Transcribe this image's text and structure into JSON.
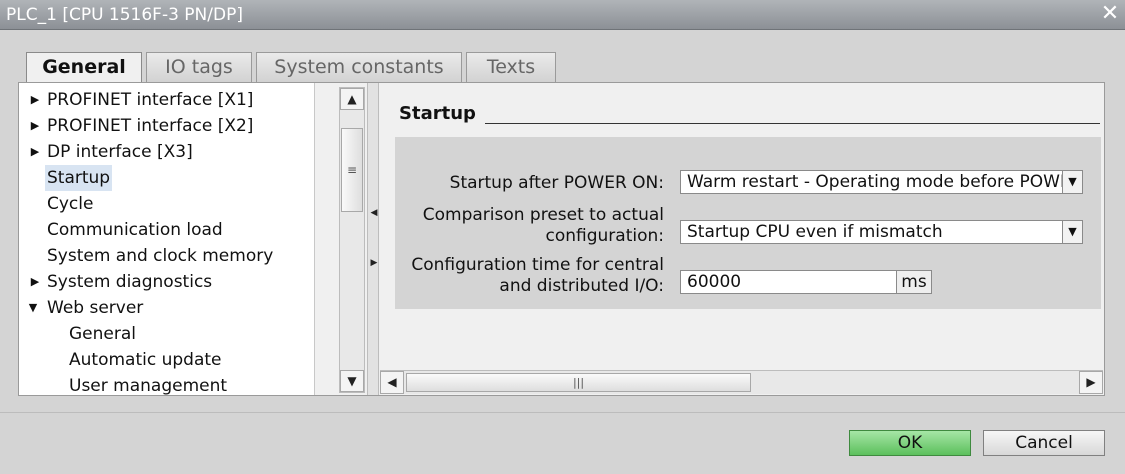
{
  "window": {
    "title": "PLC_1 [CPU 1516F-3 PN/DP]",
    "close_glyph": "✕"
  },
  "tabs": [
    {
      "label": "General",
      "active": true
    },
    {
      "label": "IO tags",
      "active": false
    },
    {
      "label": "System constants",
      "active": false
    },
    {
      "label": "Texts",
      "active": false
    }
  ],
  "tree": {
    "items": [
      {
        "label": "PROFINET interface [X1]",
        "expander": "▶",
        "selected": false
      },
      {
        "label": "PROFINET interface [X2]",
        "expander": "▶",
        "selected": false
      },
      {
        "label": "DP interface [X3]",
        "expander": "▶",
        "selected": false
      },
      {
        "label": "Startup",
        "expander": "",
        "selected": true
      },
      {
        "label": "Cycle",
        "expander": "",
        "selected": false
      },
      {
        "label": "Communication load",
        "expander": "",
        "selected": false
      },
      {
        "label": "System and clock memory",
        "expander": "",
        "selected": false
      },
      {
        "label": "System diagnostics",
        "expander": "▶",
        "selected": false
      },
      {
        "label": "Web server",
        "expander": "▼",
        "selected": false
      },
      {
        "label": "General",
        "expander": "",
        "selected": false
      },
      {
        "label": "Automatic update",
        "expander": "",
        "selected": false
      },
      {
        "label": "User management",
        "expander": "",
        "selected": false
      }
    ]
  },
  "section": {
    "title": "Startup"
  },
  "form": {
    "power_on_label": "Startup after POWER ON:",
    "power_on_value": "Warm restart - Operating mode before POWER ON",
    "comparison_label_1": "Comparison preset to actual",
    "comparison_label_2": "configuration:",
    "comparison_value": "Startup CPU even if mismatch",
    "config_time_label_1": "Configuration time for central",
    "config_time_label_2": "and distributed I/O:",
    "config_time_value": "60000",
    "config_time_unit": "ms"
  },
  "buttons": {
    "ok": "OK",
    "cancel": "Cancel"
  }
}
